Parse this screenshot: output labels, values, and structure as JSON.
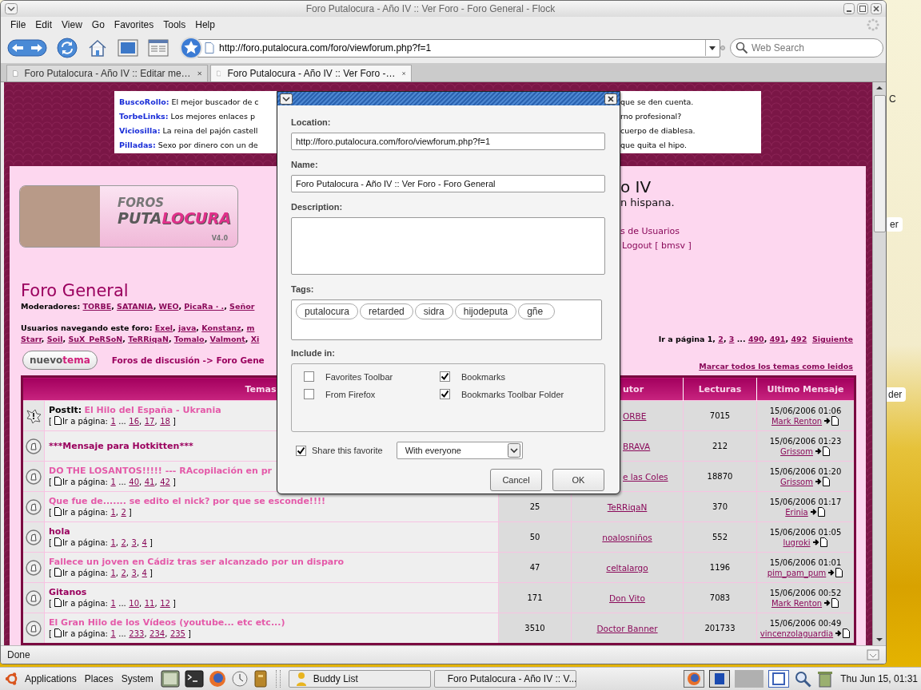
{
  "window": {
    "title": "Foro Putalocura - Año IV :: Ver Foro - Foro General - Flock"
  },
  "menu": [
    "File",
    "Edit",
    "View",
    "Go",
    "Favorites",
    "Tools",
    "Help"
  ],
  "address": {
    "url": "http://foro.putalocura.com/foro/viewforum.php?f=1"
  },
  "search": {
    "placeholder": "Web Search"
  },
  "tabs": [
    {
      "label": "Foro Putalocura - Año IV :: Editar me…",
      "selected": false
    },
    {
      "label": "Foro Putalocura - Año IV :: Ver Foro -…",
      "selected": true
    }
  ],
  "ads": [
    {
      "name": "BuscoRollo:",
      "text_left": "El mejor buscador de c",
      "text_right": "que se den cuenta."
    },
    {
      "name": "TorbeLinks:",
      "text_left": "Los mejores enlaces p",
      "text_right": "rno profesional?"
    },
    {
      "name": "Viciosilla:",
      "text_left": "La reina del pajón castell",
      "text_right": "cuerpo de diablesa."
    },
    {
      "name": "Pilladas:",
      "text_left": "Sexo por dinero con un de",
      "text_right": "que quita el hipo."
    }
  ],
  "logo": {
    "small_word": "FOROS",
    "word_a": "PUTA",
    "word_b": "LOCURA",
    "version": "V4.0"
  },
  "site_header": {
    "title_fragment": "o IV",
    "subtitle_fragment": "n hispana.",
    "users_link_fragment": "s de Usuarios",
    "logout_link": "Logout [ bmsv ]"
  },
  "forum": {
    "title": "Foro General",
    "moderators": [
      {
        "text": "Moderadores:",
        "kind": "label"
      },
      {
        "text": "TORBE",
        "kind": "link"
      },
      {
        "text": ",",
        "kind": "sep"
      },
      {
        "text": "SATANIA",
        "kind": "link"
      },
      {
        "text": ",",
        "kind": "sep"
      },
      {
        "text": "WEO",
        "kind": "link"
      },
      {
        "text": ",",
        "kind": "sep"
      },
      {
        "text": "PicaRa · .",
        "kind": "link"
      },
      {
        "text": ",",
        "kind": "sep"
      },
      {
        "text": "Señor",
        "kind": "link"
      }
    ],
    "users": [
      [
        {
          "text": "Usuarios navegando este foro:",
          "kind": "label"
        },
        {
          "text": "Exel",
          "kind": "link"
        },
        {
          "text": ",",
          "kind": "sep"
        },
        {
          "text": "java",
          "kind": "link"
        },
        {
          "text": ",",
          "kind": "sep"
        },
        {
          "text": "Konstanz",
          "kind": "link"
        },
        {
          "text": ",",
          "kind": "sep"
        },
        {
          "text": "m",
          "kind": "link"
        }
      ],
      [
        {
          "text": "Starr",
          "kind": "link"
        },
        {
          "text": ",",
          "kind": "sep"
        },
        {
          "text": "Soil",
          "kind": "link"
        },
        {
          "text": ",",
          "kind": "sep"
        },
        {
          "text": "SuX_PeRSoN",
          "kind": "link"
        },
        {
          "text": ",",
          "kind": "sep"
        },
        {
          "text": "TeRRiqaN",
          "kind": "link"
        },
        {
          "text": ",",
          "kind": "sep"
        },
        {
          "text": "Tomalo",
          "kind": "link"
        },
        {
          "text": ",",
          "kind": "sep"
        },
        {
          "text": "Valmont",
          "kind": "link"
        },
        {
          "text": ",",
          "kind": "sep"
        },
        {
          "text": "Xi",
          "kind": "link"
        }
      ]
    ],
    "pager": [
      {
        "text": "Ir a página 1,",
        "kind": "label"
      },
      {
        "text": "2",
        "kind": "link"
      },
      {
        "text": ",",
        "kind": "sep"
      },
      {
        "text": "3",
        "kind": "link"
      },
      {
        "text": "...",
        "kind": "gap"
      },
      {
        "text": "490",
        "kind": "link"
      },
      {
        "text": ",",
        "kind": "sep"
      },
      {
        "text": "491",
        "kind": "link"
      },
      {
        "text": ",",
        "kind": "sep"
      },
      {
        "text": "492",
        "kind": "link"
      },
      {
        "text": "Siguiente",
        "kind": "link"
      }
    ],
    "new_topic": {
      "word_a": "nuevo",
      "word_b": "tema"
    },
    "breadcrumb": "Foros de discusión -> Foro Gene",
    "mark_read": "Marcar todos los temas como leidos"
  },
  "table": {
    "header_topics": "Temas",
    "header_author": "utor",
    "header_reads": "Lecturas",
    "header_last": "Ultimo Mensaje",
    "rows": [
      {
        "kind": "sticky",
        "prefix": "PostIt:",
        "title": "El Hilo del España - Ukrania",
        "visited": true,
        "pager": [
          {
            "text": "[",
            "kind": "text"
          },
          {
            "text": "Ir a página:",
            "kind": "label"
          },
          {
            "text": "1",
            "kind": "link"
          },
          {
            "text": "...",
            "kind": "gap"
          },
          {
            "text": "16",
            "kind": "link"
          },
          {
            "text": ",",
            "kind": "sep"
          },
          {
            "text": "17",
            "kind": "link"
          },
          {
            "text": ",",
            "kind": "sep"
          },
          {
            "text": "18",
            "kind": "link"
          },
          {
            "text": "]",
            "kind": "text"
          }
        ],
        "author": "ORBE",
        "reads": "7015",
        "last_date": "15/06/2006 01:06",
        "last_user": "Mark Renton"
      },
      {
        "kind": "normal",
        "title": "***Mensaje para Hotkitten***",
        "visited": false,
        "author": "BRAVA",
        "reads": "212",
        "last_date": "15/06/2006 01:23",
        "last_user": "Grissom"
      },
      {
        "kind": "normal",
        "title": "DO THE LOSANTOS!!!!! --- RAcopilación en pr",
        "visited": true,
        "pager": [
          {
            "text": "[",
            "kind": "text"
          },
          {
            "text": "Ir a página:",
            "kind": "label"
          },
          {
            "text": "1",
            "kind": "link"
          },
          {
            "text": "...",
            "kind": "gap"
          },
          {
            "text": "40",
            "kind": "link"
          },
          {
            "text": ",",
            "kind": "sep"
          },
          {
            "text": "41",
            "kind": "link"
          },
          {
            "text": ",",
            "kind": "sep"
          },
          {
            "text": "42",
            "kind": "link"
          },
          {
            "text": "]",
            "kind": "text"
          }
        ],
        "author": "e las Coles",
        "reads": "18870",
        "last_date": "15/06/2006 01:20",
        "last_user": "Grissom"
      },
      {
        "kind": "normal",
        "title": "Que fue de....... se edito el nick? por que se esconde!!!!",
        "visited": true,
        "pager": [
          {
            "text": "[",
            "kind": "text"
          },
          {
            "text": "Ir a página:",
            "kind": "label"
          },
          {
            "text": "1",
            "kind": "link"
          },
          {
            "text": ",",
            "kind": "sep"
          },
          {
            "text": "2",
            "kind": "link"
          },
          {
            "text": "]",
            "kind": "text"
          }
        ],
        "replies": "25",
        "author": "TeRRiqaN",
        "reads": "370",
        "last_date": "15/06/2006 01:17",
        "last_user": "Erinia"
      },
      {
        "kind": "normal",
        "title": "hola",
        "visited": false,
        "pager": [
          {
            "text": "[",
            "kind": "text"
          },
          {
            "text": "Ir a página:",
            "kind": "label"
          },
          {
            "text": "1",
            "kind": "link"
          },
          {
            "text": ",",
            "kind": "sep"
          },
          {
            "text": "2",
            "kind": "link"
          },
          {
            "text": ",",
            "kind": "sep"
          },
          {
            "text": "3",
            "kind": "link"
          },
          {
            "text": ",",
            "kind": "sep"
          },
          {
            "text": "4",
            "kind": "link"
          },
          {
            "text": "]",
            "kind": "text"
          }
        ],
        "replies": "50",
        "author": "noalosniños",
        "reads": "552",
        "last_date": "15/06/2006 01:05",
        "last_user": "lugroki"
      },
      {
        "kind": "normal",
        "title": "Fallece un joven en Cádiz tras ser alcanzado por un disparo",
        "visited": true,
        "pager": [
          {
            "text": "[",
            "kind": "text"
          },
          {
            "text": "Ir a página:",
            "kind": "label"
          },
          {
            "text": "1",
            "kind": "link"
          },
          {
            "text": ",",
            "kind": "sep"
          },
          {
            "text": "2",
            "kind": "link"
          },
          {
            "text": ",",
            "kind": "sep"
          },
          {
            "text": "3",
            "kind": "link"
          },
          {
            "text": ",",
            "kind": "sep"
          },
          {
            "text": "4",
            "kind": "link"
          },
          {
            "text": "]",
            "kind": "text"
          }
        ],
        "replies": "47",
        "author": "celtalargo",
        "reads": "1196",
        "last_date": "15/06/2006 01:01",
        "last_user": "pim_pam_pum"
      },
      {
        "kind": "normal",
        "title": "Gitanos",
        "visited": false,
        "pager": [
          {
            "text": "[",
            "kind": "text"
          },
          {
            "text": "Ir a página:",
            "kind": "label"
          },
          {
            "text": "1",
            "kind": "link"
          },
          {
            "text": "...",
            "kind": "gap"
          },
          {
            "text": "10",
            "kind": "link"
          },
          {
            "text": ",",
            "kind": "sep"
          },
          {
            "text": "11",
            "kind": "link"
          },
          {
            "text": ",",
            "kind": "sep"
          },
          {
            "text": "12",
            "kind": "link"
          },
          {
            "text": "]",
            "kind": "text"
          }
        ],
        "replies": "171",
        "author": "Don Vito",
        "reads": "7083",
        "last_date": "15/06/2006 00:52",
        "last_user": "Mark Renton"
      },
      {
        "kind": "normal",
        "title": "El Gran Hilo de los Vídeos (youtube... etc etc...)",
        "visited": true,
        "pager": [
          {
            "text": "[",
            "kind": "text"
          },
          {
            "text": "Ir a página:",
            "kind": "label"
          },
          {
            "text": "1",
            "kind": "link"
          },
          {
            "text": "...",
            "kind": "gap"
          },
          {
            "text": "233",
            "kind": "link"
          },
          {
            "text": ",",
            "kind": "sep"
          },
          {
            "text": "234",
            "kind": "link"
          },
          {
            "text": ",",
            "kind": "sep"
          },
          {
            "text": "235",
            "kind": "link"
          },
          {
            "text": "]",
            "kind": "text"
          }
        ],
        "replies": "3510",
        "author": "Doctor Banner",
        "reads": "201733",
        "last_date": "15/06/2006 00:49",
        "last_user": "vincenzolaguardia"
      }
    ]
  },
  "dialog": {
    "location_label": "Location:",
    "location": "http://foro.putalocura.com/foro/viewforum.php?f=1",
    "name_label": "Name:",
    "name": "Foro Putalocura - Año IV :: Ver Foro - Foro General",
    "description_label": "Description:",
    "tags_label": "Tags:",
    "tags": [
      "putalocura",
      "retarded",
      "sidra",
      "hijodeputa",
      "gñe"
    ],
    "include_label": "Include in:",
    "include": [
      {
        "label": "Favorites Toolbar",
        "checked": false
      },
      {
        "label": "Bookmarks",
        "checked": true
      },
      {
        "label": "From Firefox",
        "checked": false
      },
      {
        "label": "Bookmarks Toolbar Folder",
        "checked": true
      }
    ],
    "share": {
      "label": "Share this favorite",
      "checked": true,
      "value": "With everyone"
    },
    "buttons": [
      "Cancel",
      "OK"
    ]
  },
  "status_bar": {
    "text": "Done"
  },
  "taskbar": {
    "menus": [
      "Applications",
      "Places",
      "System"
    ],
    "windows": [
      "Buddy List",
      "Foro Putalocura - Año IV :: V..."
    ],
    "clock": "Thu Jun 15, 01:31"
  },
  "desktop_fragments": [
    "C",
    "er",
    "der"
  ]
}
